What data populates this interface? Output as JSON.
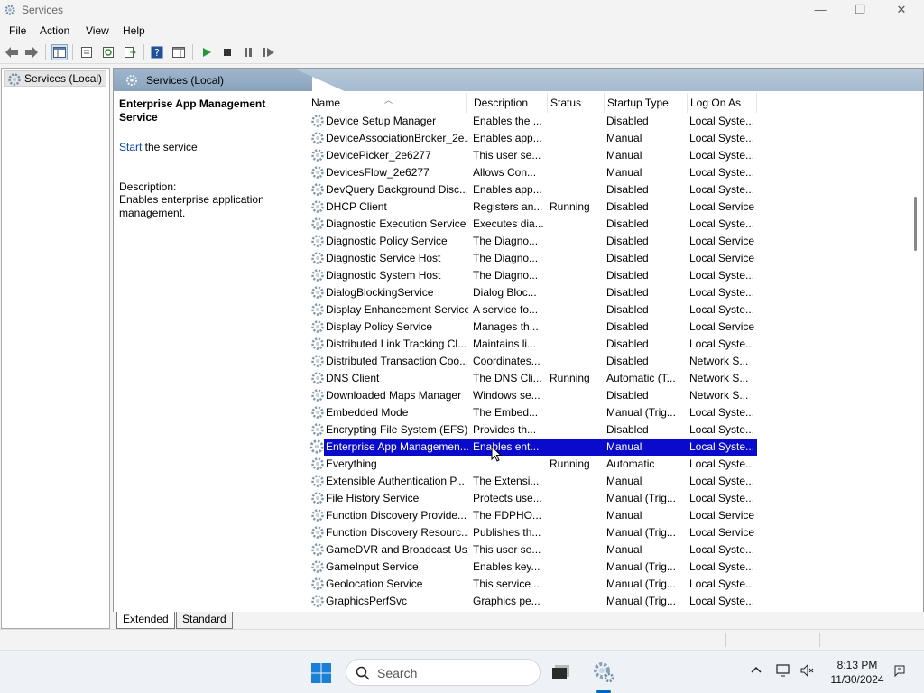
{
  "window": {
    "title": "Services",
    "minimize": "—",
    "restore": "❐",
    "close": "✕"
  },
  "menu": [
    "File",
    "Action",
    "View",
    "Help"
  ],
  "tree": {
    "root": "Services (Local)"
  },
  "main": {
    "header": "Services (Local)",
    "selected_name": "Enterprise App Management Service",
    "action_link": "Start",
    "action_rest": " the service",
    "desc_label": "Description:",
    "desc_text": "Enables enterprise application management."
  },
  "columns": [
    "Name",
    "Description",
    "Status",
    "Startup Type",
    "Log On As"
  ],
  "rows": [
    {
      "name": "Device Setup Manager",
      "desc": "Enables the ...",
      "status": "",
      "startup": "Disabled",
      "logon": "Local Syste..."
    },
    {
      "name": "DeviceAssociationBroker_2e...",
      "desc": "Enables app...",
      "status": "",
      "startup": "Manual",
      "logon": "Local Syste..."
    },
    {
      "name": "DevicePicker_2e6277",
      "desc": "This user se...",
      "status": "",
      "startup": "Manual",
      "logon": "Local Syste..."
    },
    {
      "name": "DevicesFlow_2e6277",
      "desc": "Allows Con...",
      "status": "",
      "startup": "Manual",
      "logon": "Local Syste..."
    },
    {
      "name": "DevQuery Background Disc...",
      "desc": "Enables app...",
      "status": "",
      "startup": "Disabled",
      "logon": "Local Syste..."
    },
    {
      "name": "DHCP Client",
      "desc": "Registers an...",
      "status": "Running",
      "startup": "Disabled",
      "logon": "Local Service"
    },
    {
      "name": "Diagnostic Execution Service",
      "desc": "Executes dia...",
      "status": "",
      "startup": "Disabled",
      "logon": "Local Syste..."
    },
    {
      "name": "Diagnostic Policy Service",
      "desc": "The Diagno...",
      "status": "",
      "startup": "Disabled",
      "logon": "Local Service"
    },
    {
      "name": "Diagnostic Service Host",
      "desc": "The Diagno...",
      "status": "",
      "startup": "Disabled",
      "logon": "Local Service"
    },
    {
      "name": "Diagnostic System Host",
      "desc": "The Diagno...",
      "status": "",
      "startup": "Disabled",
      "logon": "Local Syste..."
    },
    {
      "name": "DialogBlockingService",
      "desc": "Dialog Bloc...",
      "status": "",
      "startup": "Disabled",
      "logon": "Local Syste..."
    },
    {
      "name": "Display Enhancement Service",
      "desc": "A service fo...",
      "status": "",
      "startup": "Disabled",
      "logon": "Local Syste..."
    },
    {
      "name": "Display Policy Service",
      "desc": "Manages th...",
      "status": "",
      "startup": "Disabled",
      "logon": "Local Service"
    },
    {
      "name": "Distributed Link Tracking Cl...",
      "desc": "Maintains li...",
      "status": "",
      "startup": "Disabled",
      "logon": "Local Syste..."
    },
    {
      "name": "Distributed Transaction Coo...",
      "desc": "Coordinates...",
      "status": "",
      "startup": "Disabled",
      "logon": "Network S..."
    },
    {
      "name": "DNS Client",
      "desc": "The DNS Cli...",
      "status": "Running",
      "startup": "Automatic (T...",
      "logon": "Network S..."
    },
    {
      "name": "Downloaded Maps Manager",
      "desc": "Windows se...",
      "status": "",
      "startup": "Disabled",
      "logon": "Network S..."
    },
    {
      "name": "Embedded Mode",
      "desc": "The Embed...",
      "status": "",
      "startup": "Manual (Trig...",
      "logon": "Local Syste..."
    },
    {
      "name": "Encrypting File System (EFS)",
      "desc": "Provides th...",
      "status": "",
      "startup": "Disabled",
      "logon": "Local Syste..."
    },
    {
      "name": "Enterprise App Managemen...",
      "desc": "Enables ent...",
      "status": "",
      "startup": "Manual",
      "logon": "Local Syste..."
    },
    {
      "name": "Everything",
      "desc": "",
      "status": "Running",
      "startup": "Automatic",
      "logon": "Local Syste..."
    },
    {
      "name": "Extensible Authentication P...",
      "desc": "The Extensi...",
      "status": "",
      "startup": "Manual",
      "logon": "Local Syste..."
    },
    {
      "name": "File History Service",
      "desc": "Protects use...",
      "status": "",
      "startup": "Manual (Trig...",
      "logon": "Local Syste..."
    },
    {
      "name": "Function Discovery Provide...",
      "desc": "The FDPHO...",
      "status": "",
      "startup": "Manual",
      "logon": "Local Service"
    },
    {
      "name": "Function Discovery Resourc...",
      "desc": "Publishes th...",
      "status": "",
      "startup": "Manual (Trig...",
      "logon": "Local Service"
    },
    {
      "name": "GameDVR and Broadcast Us...",
      "desc": "This user se...",
      "status": "",
      "startup": "Manual",
      "logon": "Local Syste..."
    },
    {
      "name": "GameInput Service",
      "desc": "Enables key...",
      "status": "",
      "startup": "Manual (Trig...",
      "logon": "Local Syste..."
    },
    {
      "name": "Geolocation Service",
      "desc": "This service ...",
      "status": "",
      "startup": "Manual (Trig...",
      "logon": "Local Syste..."
    },
    {
      "name": "GraphicsPerfSvc",
      "desc": "Graphics pe...",
      "status": "",
      "startup": "Manual (Trig...",
      "logon": "Local Syste..."
    }
  ],
  "selected_index": 19,
  "tabs": [
    "Extended",
    "Standard"
  ],
  "taskbar": {
    "search_placeholder": "Search",
    "time": "8:13 PM",
    "date": "11/30/2024"
  },
  "colors": {
    "selection": "#0a0acc",
    "link": "#0645ad",
    "accent": "#0067c0"
  }
}
